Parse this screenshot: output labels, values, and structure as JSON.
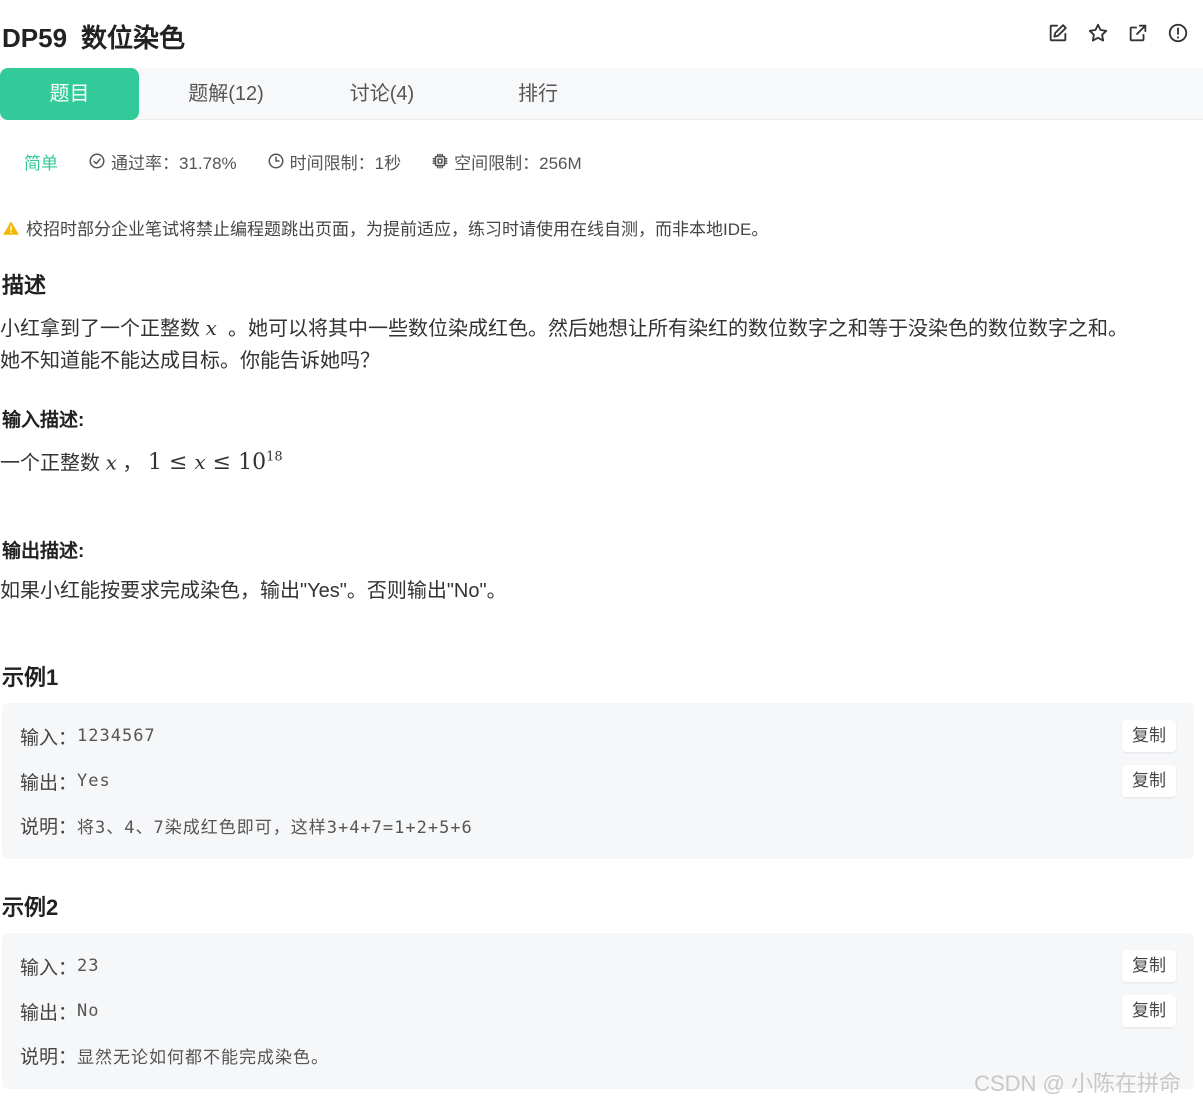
{
  "problem": {
    "code": "DP59",
    "title": "数位染色"
  },
  "header_icons": [
    "edit-icon",
    "star-icon",
    "external-link-icon",
    "report-icon"
  ],
  "tabs": [
    {
      "label": "题目",
      "active": true
    },
    {
      "label": "题解(12)",
      "active": false
    },
    {
      "label": "讨论(4)",
      "active": false
    },
    {
      "label": "排行",
      "active": false
    }
  ],
  "meta": {
    "difficulty": "简单",
    "pass_rate": "通过率：31.78%",
    "time_limit": "时间限制：1秒",
    "space_limit": "空间限制：256M"
  },
  "notice": "校招时部分企业笔试将禁止编程题跳出页面，为提前适应，练习时请使用在线自测，而非本地IDE。",
  "description": {
    "heading": "描述",
    "line1_a": "小红拿到了一个正整数",
    "var_x": "x",
    "line1_b": "。她可以将其中一些数位染成红色。然后她想让所有染红的数位数字之和等于没染色的数位数字之和。",
    "line2": "她不知道能不能达成目标。你能告诉她吗？"
  },
  "input_desc": {
    "heading": "输入描述:",
    "text_a": "一个正整数",
    "var_x": "x",
    "sep": "，",
    "constraint_left": "1 ≤ ",
    "constraint_right": " ≤ 10",
    "exp": "18"
  },
  "output_desc": {
    "heading": "输出描述:",
    "text": "如果小红能按要求完成染色，输出\"Yes\"。否则输出\"No\"。"
  },
  "examples": [
    {
      "heading": "示例1",
      "input_label": "输入：",
      "input": "1234567",
      "output_label": "输出：",
      "output": "Yes",
      "note_label": "说明：",
      "note": "将3、4、7染成红色即可，这样3+4+7=1+2+5+6",
      "copy_label": "复制"
    },
    {
      "heading": "示例2",
      "input_label": "输入：",
      "input": "23",
      "output_label": "输出：",
      "output": "No",
      "note_label": "说明：",
      "note": "显然无论如何都不能完成染色。",
      "copy_label": "复制"
    }
  ],
  "watermark": "CSDN @ 小陈在拼命",
  "colors": {
    "accent": "#32ca99",
    "warning": "#f5b700"
  }
}
